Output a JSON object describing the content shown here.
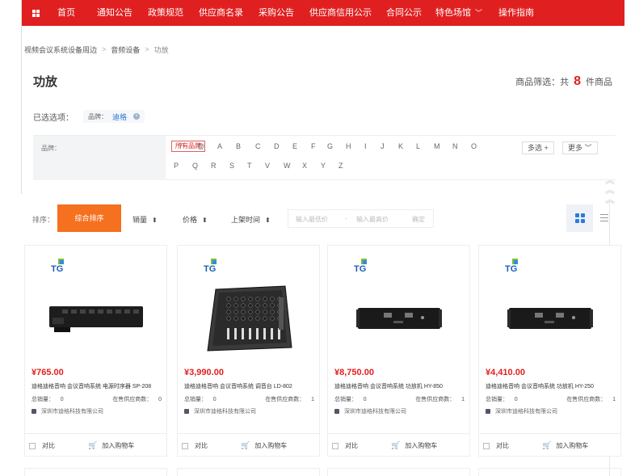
{
  "nav": {
    "items": [
      "首页",
      "通知公告",
      "政策规范",
      "供应商名录",
      "采购公告",
      "供应商信用公示",
      "合同公示",
      "特色场馆",
      "操作指南"
    ],
    "color": "#e02020"
  },
  "breadcrumb": [
    "视频会议系统设备周边",
    "音频设备",
    "功放"
  ],
  "page_title": "功放",
  "count": {
    "prefix": "商品筛选：共",
    "value": "8",
    "suffix": "件商品"
  },
  "selected": {
    "label": "已选选项：",
    "chip_key": "品牌：",
    "chip_value": "迪格"
  },
  "brand_filter": {
    "label": "品牌：",
    "all_label": "所有品牌",
    "row1": [
      "7",
      "@",
      "A",
      "B",
      "C",
      "D",
      "E",
      "F",
      "G",
      "H",
      "I",
      "J",
      "K",
      "L",
      "M",
      "N",
      "O"
    ],
    "row2": [
      "P",
      "Q",
      "R",
      "S",
      "T",
      "V",
      "W",
      "X",
      "Y",
      "Z"
    ],
    "multi_label": "多选",
    "more_label": "更多"
  },
  "sort": {
    "label": "排序：",
    "active": "综合排序",
    "sales": "销量",
    "price": "价格",
    "time": "上架时间",
    "price_min_placeholder": "输入最低价",
    "price_max_placeholder": "输入最高价",
    "price_dash": "-",
    "confirm": "确定",
    "accent": "#f5701f"
  },
  "products": [
    {
      "price": "¥765.00",
      "name": "迪格迪格音响 会议音响系统 电源时序器 SP-208",
      "sales_label": "总销量：",
      "sales": "0",
      "suppliers_label": "在售供应商数：",
      "suppliers": "0",
      "company": "深圳市迪格科技有限公司",
      "compare": "对比",
      "add_cart": "加入购物车",
      "image": "power-sequencer"
    },
    {
      "price": "¥3,990.00",
      "name": "迪格迪格音响 会议音响系统 调音台 LD-802",
      "sales_label": "总销量：",
      "sales": "0",
      "suppliers_label": "在售供应商数：",
      "suppliers": "1",
      "company": "深圳市迪格科技有限公司",
      "compare": "对比",
      "add_cart": "加入购物车",
      "image": "mixer"
    },
    {
      "price": "¥8,750.00",
      "name": "迪格迪格音响 会议音响系统 功放机 HY-850",
      "sales_label": "总销量：",
      "sales": "0",
      "suppliers_label": "在售供应商数：",
      "suppliers": "1",
      "company": "深圳市迪格科技有限公司",
      "compare": "对比",
      "add_cart": "加入购物车",
      "image": "amplifier"
    },
    {
      "price": "¥4,410.00",
      "name": "迪格迪格音响 会议音响系统 功放机 HY-250",
      "sales_label": "总销量：",
      "sales": "0",
      "suppliers_label": "在售供应商数：",
      "suppliers": "1",
      "company": "深圳市迪格科技有限公司",
      "compare": "对比",
      "add_cart": "加入购物车",
      "image": "amplifier"
    }
  ]
}
